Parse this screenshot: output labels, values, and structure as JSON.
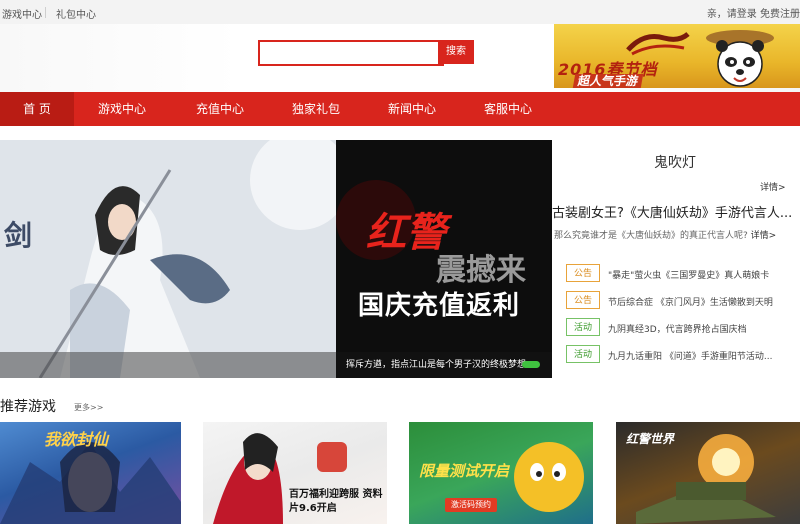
{
  "topbar": {
    "game_center": "游戏中心",
    "gift_center": "礼包中心",
    "login_prompt": "亲，请登录 免费注册"
  },
  "search": {
    "button_label": "搜索",
    "value": ""
  },
  "banner_ad": {
    "line1": "2016春节档",
    "line2": "超人气手游"
  },
  "nav": {
    "items": [
      {
        "label": "首 页"
      },
      {
        "label": "游戏中心"
      },
      {
        "label": "充值中心"
      },
      {
        "label": "独家礼包"
      },
      {
        "label": "新闻中心"
      },
      {
        "label": "客服中心"
      }
    ]
  },
  "slider": {
    "right_title": "红警",
    "right_sub1": "震撼来",
    "right_sub2": "国庆充值返利",
    "caption": "挥斥方遒，指点江山是每个男子汉的终极梦想"
  },
  "side": {
    "title": "鬼吹灯",
    "more1": "详情>",
    "headline": "古装剧女王?《大唐仙妖劫》手游代言人...",
    "sub_text": "那么究竟谁才是《大唐仙妖劫》的真正代言人呢?",
    "sub_more": "详情>",
    "news": [
      {
        "tag": "公告",
        "text": "\"暴走\"萤火虫《三国罗曼史》真人萌娘卡"
      },
      {
        "tag": "公告",
        "text": "节后综合症 《京门风月》生活懒散到天明"
      },
      {
        "tag": "活动",
        "text": "九阴真经3D，代言跨界抢占国庆档"
      },
      {
        "tag": "活动",
        "text": "九月九话重阳 《问道》手游重阳节活动..."
      }
    ]
  },
  "recommend": {
    "title": "推荐游戏",
    "more": "更多>>",
    "games": [
      {
        "title": "我欲封仙"
      },
      {
        "title": "百万福利迎跨服 资料片9.6开启"
      },
      {
        "title": "限量测试开启",
        "button": "激活码预约"
      },
      {
        "title": "红警世界"
      }
    ]
  },
  "colors": {
    "brand_red": "#d8251d",
    "tag_orange": "#e8a33a",
    "tag_green": "#77c266"
  }
}
